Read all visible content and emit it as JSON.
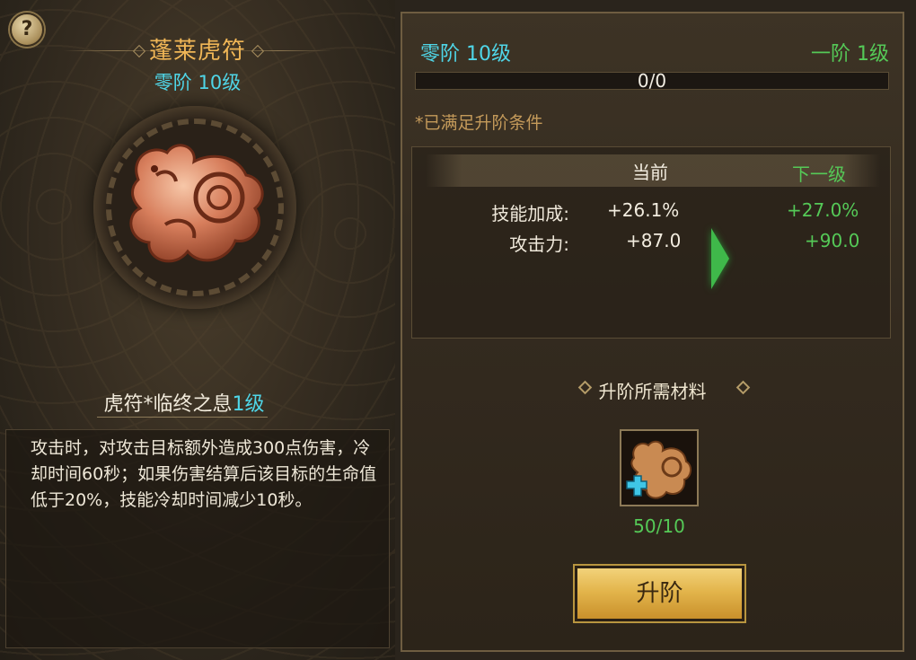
{
  "help": {
    "label": "?"
  },
  "header": {
    "title": "蓬莱虎符",
    "stage": "零阶 10级"
  },
  "skill": {
    "name": "虎符*临终之息",
    "level": "1级",
    "description": "攻击时，对攻击目标额外造成300点伤害，冷却时间60秒；如果伤害结算后该目标的生命值低于20%，技能冷却时间减少10秒。"
  },
  "upgrade": {
    "current_stage": "零阶 10级",
    "next_stage": "一阶 1级",
    "progress": {
      "text": "0/0",
      "fraction": 0
    },
    "condition": "*已满足升阶条件",
    "columns": {
      "current": "当前",
      "next": "下一级"
    },
    "rows": [
      {
        "label": "技能加成:",
        "current": "+26.1%",
        "next": "+27.0%"
      },
      {
        "label": "攻击力:",
        "current": "+87.0",
        "next": "+90.0"
      }
    ],
    "materials_title": "升阶所需材料",
    "material": {
      "count": "50/10",
      "icon": "tiger-talisman-icon"
    },
    "button_label": "升阶"
  },
  "colors": {
    "stage": "#4fd6e8",
    "next": "#55c957",
    "title": "#f0b656",
    "button": "#e3b54c"
  }
}
